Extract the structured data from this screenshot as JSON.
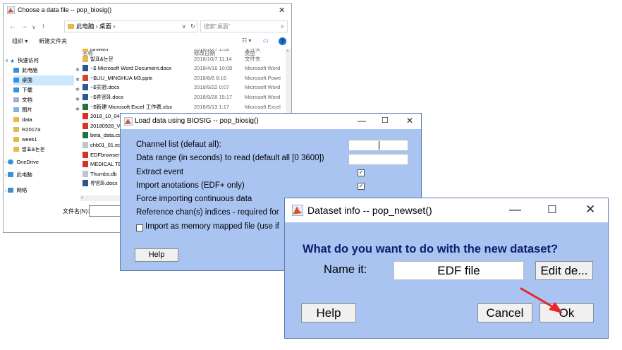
{
  "file_dialog": {
    "title": "Choose a data file -- pop_biosig()",
    "close": "✕",
    "nav": {
      "back": "←",
      "forward": "→",
      "dropdown": "∨",
      "up": "↑",
      "address_dropdown": "∨",
      "refresh": "↻"
    },
    "address": "此电脑 › 桌面 ›",
    "search_placeholder": "搜索\"桌面\"",
    "search_icon": "⌕",
    "commands": {
      "organize": "组织 ▾",
      "new_folder": "新建文件夹",
      "view": "☷ ▾",
      "pane": "▭",
      "help": "?"
    },
    "sidebar": [
      {
        "label": "快速访问",
        "icon": "star-icon"
      },
      {
        "label": "此电脑",
        "icon": "computer-icon"
      },
      {
        "label": "桌面",
        "icon": "desktop-folder-icon"
      },
      {
        "label": "下载",
        "icon": "download-folder-icon"
      },
      {
        "label": "文档",
        "icon": "documents-folder-icon"
      },
      {
        "label": "图片",
        "icon": "pictures-folder-icon"
      },
      {
        "label": "data",
        "icon": "folder-icon"
      },
      {
        "label": "R2017a",
        "icon": "folder-icon"
      },
      {
        "label": "week1",
        "icon": "folder-icon"
      },
      {
        "label": "발표&논문",
        "icon": "folder-icon"
      },
      {
        "label": "OneDrive",
        "icon": "cloud-icon"
      },
      {
        "label": "此电脑",
        "icon": "computer-icon"
      },
      {
        "label": "网络",
        "icon": "network-icon"
      }
    ],
    "columns": {
      "name": "名称",
      "date": "修改日期",
      "type": "类型"
    },
    "files": [
      {
        "name": "luniwen",
        "date": "2018/10/7 1:08",
        "type": "文件夹"
      },
      {
        "name": "발표&논문",
        "date": "2018/10/7 11:14",
        "type": "文件夹"
      },
      {
        "name": "~$ Microsoft Word Document.docx",
        "date": "2018/4/16 10:08",
        "type": "Microsoft Word"
      },
      {
        "name": "~$LIU_MINGHUA M3.pptx",
        "date": "2018/8/6 8:16",
        "type": "Microsoft Powe"
      },
      {
        "name": "~$实验.docx",
        "date": "2018/9/22 0:07",
        "type": "Microsoft Word"
      },
      {
        "name": "~$류영화.docx",
        "date": "2018/9/28 15:17",
        "type": "Microsoft Word"
      },
      {
        "name": "~$新建 Microsoft Excel 工作表.xlsx",
        "date": "2018/9/13 1:17",
        "type": "Microsoft Excel"
      },
      {
        "name": "2018_10_04",
        "date": "",
        "type": ""
      },
      {
        "name": "20180928_V",
        "date": "",
        "type": ""
      },
      {
        "name": "beta_data.cs",
        "date": "",
        "type": ""
      },
      {
        "name": "chb01_01.ed",
        "date": "",
        "type": ""
      },
      {
        "name": "EDFbrowser",
        "date": "",
        "type": ""
      },
      {
        "name": "MEDICAL TE",
        "date": "",
        "type": ""
      },
      {
        "name": "Thumbs.db",
        "date": "",
        "type": ""
      },
      {
        "name": "류영화.docx",
        "date": "",
        "type": ""
      }
    ],
    "filename_label": "文件名(N):",
    "colors": {
      "selection": "#cce8ff",
      "folder": "#e8b949",
      "word": "#2b579a",
      "ppt": "#d24726",
      "pdf": "#d93025",
      "excel": "#217346"
    }
  },
  "biosig_dialog": {
    "title": "Load data using BIOSIG -- pop_biosig()",
    "controls": {
      "minimize": "—",
      "maximize": "☐",
      "close": "✕"
    },
    "fields": [
      {
        "label": "Channel list (defaut all):"
      },
      {
        "label": "Data range (in seconds) to read (default all [0 3600])"
      },
      {
        "label": "Extract event"
      },
      {
        "label": "Import anotations (EDF+ only)"
      },
      {
        "label": "Force importing continuous data"
      },
      {
        "label": "Reference chan(s) indices - required for"
      }
    ],
    "extract_event_checked": "✓",
    "import_annotations_checked": "✓",
    "memory_mapped_label": "Import as memory mapped file (use if",
    "help_label": "Help",
    "background": "#aac4f2"
  },
  "dataset_dialog": {
    "title": "Dataset info -- pop_newset()",
    "controls": {
      "minimize": "—",
      "maximize": "☐",
      "close": "✕"
    },
    "question": "What do you want to do with the new dataset?",
    "name_label": "Name it:",
    "name_value": "EDF file",
    "edit_label": "Edit de...",
    "help_label": "Help",
    "cancel_label": "Cancel",
    "ok_label": "Ok",
    "question_color": "#0b1d6b",
    "arrow_color": "#e8262b"
  }
}
